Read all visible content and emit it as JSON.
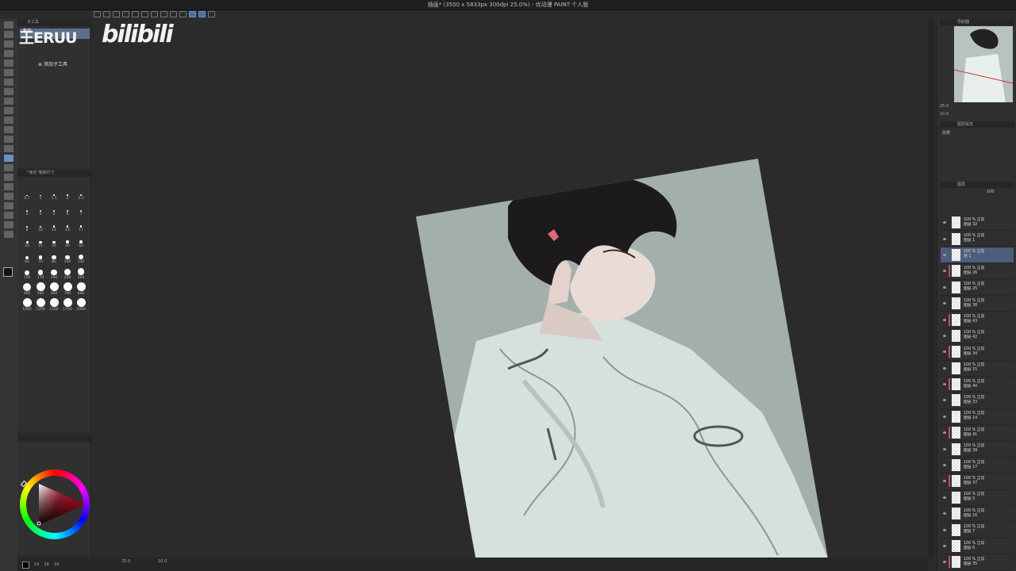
{
  "window": {
    "title": "插画* (3500 x 5833px 300dpi 25.0%) - 优动漫 PAINT 个人版"
  },
  "watermark": {
    "channel_text": "王ERUU",
    "platform_text": "bilibili"
  },
  "subtool_panel": {
    "header": "子工具",
    "active_tab_label": "液化",
    "add_subtool_label": "添加子工具"
  },
  "brush_size_panel": {
    "header": "\"液化\"笔刷尺寸",
    "sizes": [
      "0.7",
      "1",
      "1.5",
      "2",
      "2.5",
      "3",
      "4",
      "5",
      "6",
      "7",
      "8",
      "10",
      "12",
      "15",
      "17",
      "20",
      "25",
      "30",
      "40",
      "50",
      "60",
      "70",
      "80",
      "100",
      "120",
      "150",
      "170",
      "200",
      "250",
      "300",
      "400",
      "500",
      "600",
      "700",
      "800",
      "1000",
      "1200",
      "1500",
      "1700",
      "2000"
    ]
  },
  "color_values": {
    "r": "19",
    "g": "19",
    "b": "19"
  },
  "canvas_status": {
    "zoom": "25.0",
    "angle": "10.0"
  },
  "navigator": {
    "header": "导航器",
    "zoom": "25.0",
    "angle": "10.0"
  },
  "layer_property": {
    "header": "图层属性",
    "effect_label": "效果"
  },
  "layers_panel": {
    "header": "图层",
    "opacity": "100",
    "layers": [
      {
        "mode": "100 % 正常",
        "name": "图层 32",
        "marker": "",
        "selected": false
      },
      {
        "mode": "100 % 正常",
        "name": "图层 1",
        "marker": "",
        "selected": false
      },
      {
        "mode": "100 % 正常",
        "name": "组 1",
        "marker": "",
        "selected": true
      },
      {
        "mode": "100 % 正常",
        "name": "图层 26",
        "marker": "#c44d5e",
        "selected": false
      },
      {
        "mode": "100 % 正常",
        "name": "图层 25",
        "marker": "",
        "selected": false
      },
      {
        "mode": "100 % 正常",
        "name": "图层 38",
        "marker": "",
        "selected": false
      },
      {
        "mode": "100 % 正常",
        "name": "图层 43",
        "marker": "#c44d5e",
        "selected": false
      },
      {
        "mode": "100 % 正常",
        "name": "图层 42",
        "marker": "",
        "selected": false
      },
      {
        "mode": "100 % 正常",
        "name": "图层 34",
        "marker": "#c44d5e",
        "selected": false
      },
      {
        "mode": "100 % 正常",
        "name": "图层 15",
        "marker": "",
        "selected": false
      },
      {
        "mode": "100 % 正常",
        "name": "图层 40",
        "marker": "#c44d5e",
        "selected": false
      },
      {
        "mode": "100 % 正常",
        "name": "图层 33",
        "marker": "",
        "selected": false
      },
      {
        "mode": "100 % 正常",
        "name": "图层 14",
        "marker": "",
        "selected": false
      },
      {
        "mode": "100 % 正常",
        "name": "图层 41",
        "marker": "#c44d5e",
        "selected": false
      },
      {
        "mode": "100 % 正常",
        "name": "图层 39",
        "marker": "",
        "selected": false
      },
      {
        "mode": "100 % 正常",
        "name": "图层 17",
        "marker": "",
        "selected": false
      },
      {
        "mode": "100 % 正常",
        "name": "图层 37",
        "marker": "#c44d5e",
        "selected": false
      },
      {
        "mode": "100 % 正常",
        "name": "图层 5",
        "marker": "",
        "selected": false
      },
      {
        "mode": "100 % 正常",
        "name": "图层 16",
        "marker": "",
        "selected": false
      },
      {
        "mode": "100 % 正常",
        "name": "图层 7",
        "marker": "",
        "selected": false
      },
      {
        "mode": "100 % 正常",
        "name": "图层 6",
        "marker": "",
        "selected": false
      },
      {
        "mode": "100 % 正常",
        "name": "图层 35",
        "marker": "#c44d5e",
        "selected": false
      }
    ]
  },
  "colors": {
    "app_bg": "#2b2b2b",
    "panel_bg": "#303030",
    "accent": "#4e5d7a",
    "canvas_paper": "#a3afab"
  }
}
